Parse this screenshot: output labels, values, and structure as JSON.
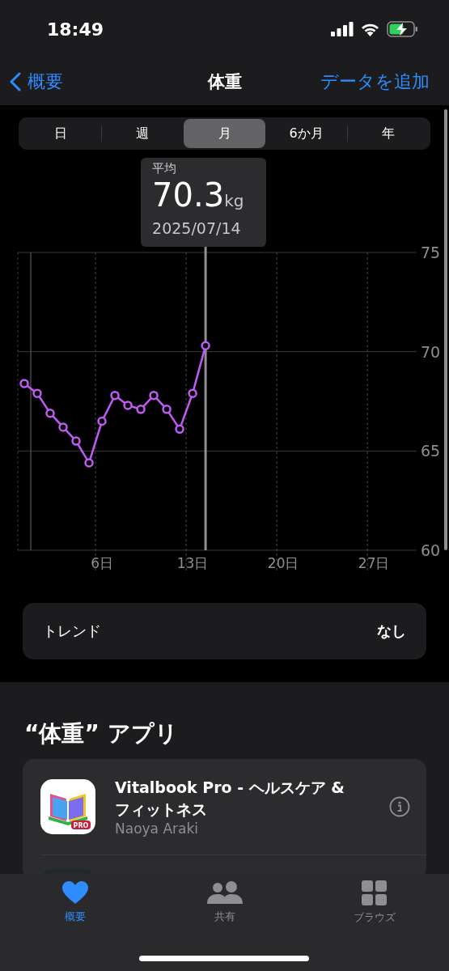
{
  "status_bar": {
    "time": "18:49"
  },
  "nav": {
    "back": "概要",
    "title": "体重",
    "action": "データを追加"
  },
  "segments": [
    {
      "label": "日",
      "selected": false
    },
    {
      "label": "週",
      "selected": false
    },
    {
      "label": "月",
      "selected": true
    },
    {
      "label": "6か月",
      "selected": false
    },
    {
      "label": "年",
      "selected": false
    }
  ],
  "chart": {
    "tooltip": {
      "label": "平均",
      "value": "70.3",
      "unit": "kg",
      "date": "2025/07/14"
    },
    "chart_data": {
      "type": "line",
      "x": [
        0,
        1,
        2,
        3,
        4,
        5,
        6,
        7,
        8,
        9,
        10,
        11,
        12,
        13,
        14
      ],
      "series": [
        {
          "color": "#bf5af2",
          "marker": "o",
          "values": [
            68.4,
            67.9,
            66.9,
            66.2,
            65.5,
            64.4,
            66.5,
            67.8,
            67.3,
            67.1,
            67.8,
            67.1,
            66.1,
            67.9,
            70.3
          ]
        }
      ],
      "xlim": [
        -0.5,
        30.3
      ],
      "ylim": [
        60,
        75
      ],
      "xticks": [
        {
          "value": 6,
          "label": "6日"
        },
        {
          "value": 13,
          "label": "13日"
        },
        {
          "value": 20,
          "label": "20日"
        },
        {
          "value": 27,
          "label": "27日"
        }
      ],
      "yticks": [
        60,
        65,
        70,
        75
      ],
      "ref_lines": [
        {
          "axis": "x",
          "value": 14,
          "color": "#8e8e93"
        },
        {
          "axis": "x",
          "value": 0.5,
          "color": "#48484a"
        }
      ]
    }
  },
  "trend": {
    "label": "トレンド",
    "value": "なし"
  },
  "apps_section": {
    "title": "“体重” アプリ",
    "apps": [
      {
        "kind": "app",
        "name": "Vitalbook Pro - ヘルスケア & フィットネス",
        "developer": "Naoya Araki",
        "badge": "PRO"
      },
      {
        "kind": "hidden"
      }
    ]
  },
  "tab_bar": [
    {
      "label": "概要",
      "selected": true
    },
    {
      "label": "共有",
      "selected": false
    },
    {
      "label": "ブラウズ",
      "selected": false
    }
  ]
}
